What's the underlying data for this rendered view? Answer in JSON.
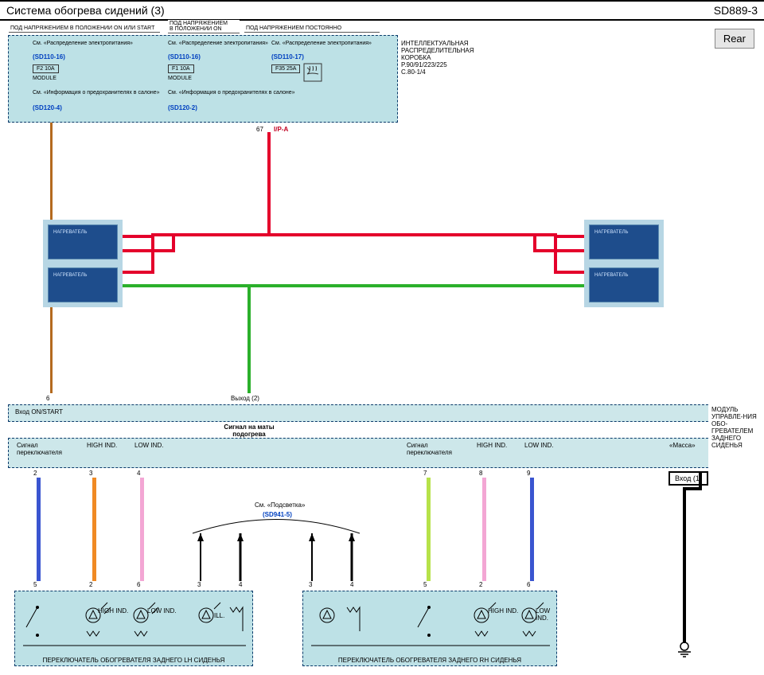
{
  "header": {
    "title_left": "Система обогрева сидений (3)",
    "title_right": "SD889-3"
  },
  "rear_button": "Rear",
  "top_headers": {
    "h1": "ПОД НАПРЯЖЕНИЕМ В ПОЛОЖЕНИИ ON ИЛИ START",
    "h2a": "ПОД НАПРЯЖЕНИЕМ",
    "h2b": "В ПОЛОЖЕНИИ ON",
    "h3": "ПОД НАПРЯЖЕНИЕМ ПОСТОЯННО"
  },
  "pdbox": {
    "see_power": "См. «Распределение электропитания»",
    "ref1": "(SD110-16)",
    "ref2": "(SD110-16)",
    "ref3": "(SD110-17)",
    "fuse1": "F2 10A",
    "fuse2": "F1 10A",
    "fuse3": "F35 25A",
    "module": "MODULE",
    "see_fuse": "См. «Информация о предохранителях в салоне»",
    "sref1": "(SD120-4)",
    "sref2": "(SD120-2)",
    "side_title": "ИНТЕЛЛЕКТУАЛЬНАЯ РАСПРЕДЕЛИТЕЛЬНАЯ КОРОБКА",
    "side_p": "P.90/91/223/225",
    "side_c": "C.80-1/4"
  },
  "connector_67": "67",
  "ipa": "I/P-A",
  "heater_photo": "НАГРЕВАТЕЛЬ",
  "module_bar": {
    "in_onstart": "Вход ON/START",
    "out2": "Выход (2)",
    "signal_mat": "Сигнал на маты подогрева",
    "sig_sw": "Сигнал переключателя",
    "high_ind": "HIGH IND.",
    "low_ind": "LOW IND.",
    "mass": "«Масса»",
    "in1": "Вход (1)",
    "side": "МОДУЛЬ УПРАВЛЕ-НИЯ ОБО-ГРЕВАТЕЛЕМ ЗАДНЕГО СИДЕНЬЯ"
  },
  "pins": {
    "p6l": "6",
    "p2": "2",
    "p3": "3",
    "p4": "4",
    "p7": "7",
    "p8": "8",
    "p9": "9",
    "sw5": "5",
    "sw2b": "2",
    "sw6": "6",
    "sw3": "3",
    "sw4": "4"
  },
  "illum": {
    "see": "См. «Подсветка»",
    "ref": "(SD941-5)"
  },
  "switch": {
    "lh": "ПЕРЕКЛЮЧАТЕЛЬ ОБОГРЕВАТЕЛЯ ЗАДНЕГО LH СИДЕНЬЯ",
    "rh": "ПЕРЕКЛЮЧАТЕЛЬ ОБОГРЕВАТЕЛЯ ЗАДНЕГО RH СИДЕНЬЯ",
    "high": "HIGH IND.",
    "low": "LOW IND.",
    "ill": "ILL."
  }
}
